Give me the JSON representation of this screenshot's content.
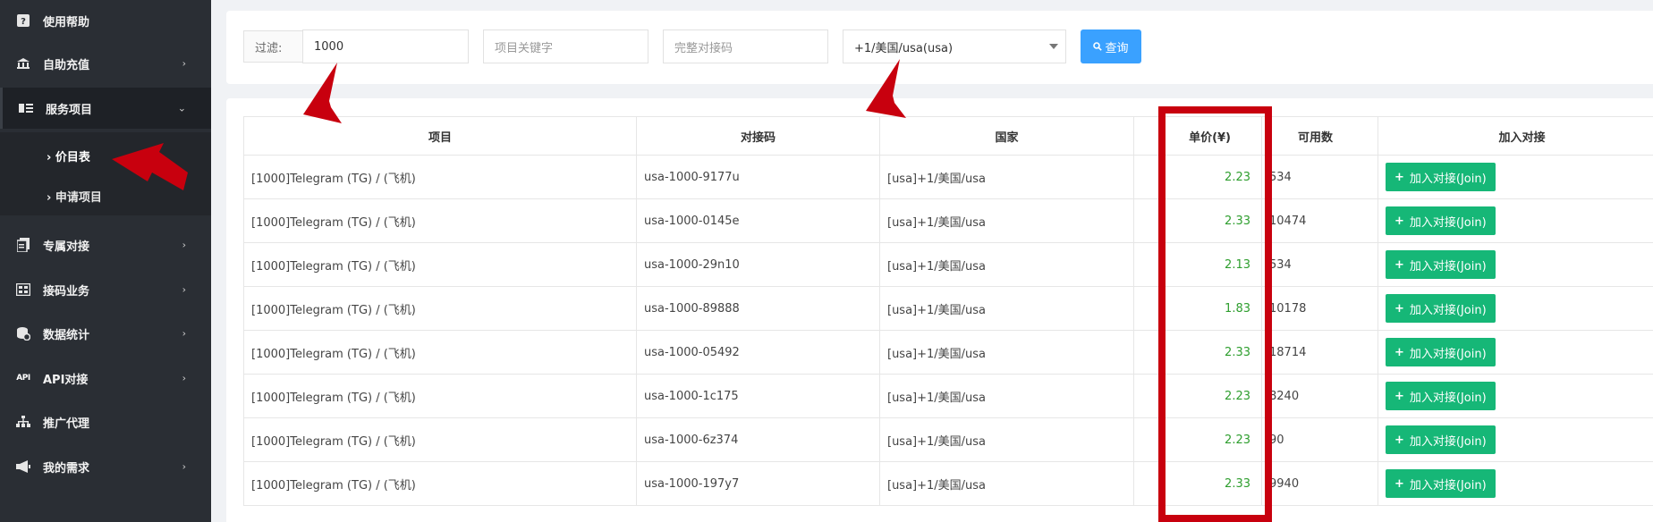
{
  "sidebar": {
    "items": [
      {
        "label": "使用帮助",
        "icon": "question-icon",
        "chevron": false
      },
      {
        "label": "自助充值",
        "icon": "bank-icon",
        "chevron": true
      },
      {
        "label": "服务项目",
        "icon": "list-icon",
        "chevron": true,
        "expanded": true
      },
      {
        "label": "专属对接",
        "icon": "document-icon",
        "chevron": true
      },
      {
        "label": "接码业务",
        "icon": "grid-icon",
        "chevron": true
      },
      {
        "label": "数据统计",
        "icon": "database-icon",
        "chevron": true
      },
      {
        "label": "API对接",
        "icon": "api-icon",
        "chevron": true
      },
      {
        "label": "推广代理",
        "icon": "sitemap-icon",
        "chevron": false
      },
      {
        "label": "我的需求",
        "icon": "bullhorn-icon",
        "chevron": true
      }
    ],
    "submenu": [
      {
        "label": "› 价目表",
        "selected": true
      },
      {
        "label": "› 申请项目",
        "selected": false
      }
    ]
  },
  "filter": {
    "label": "过滤:",
    "project_id_value": "1000",
    "keyword_placeholder": "项目关键字",
    "code_placeholder": "完整对接码",
    "country_selected": "+1/美国/usa(usa)",
    "query_label": "查询"
  },
  "table": {
    "headers": [
      "项目",
      "对接码",
      "国家",
      "单价(¥)",
      "可用数",
      "加入对接"
    ],
    "join_label": "加入对接(Join)",
    "rows": [
      {
        "project": "[1000]Telegram (TG) / (飞机)",
        "code": "usa-1000-9177u",
        "country": "[usa]+1/美国/usa",
        "price": "2.23",
        "available": "534"
      },
      {
        "project": "[1000]Telegram (TG) / (飞机)",
        "code": "usa-1000-0145e",
        "country": "[usa]+1/美国/usa",
        "price": "2.33",
        "available": "10474"
      },
      {
        "project": "[1000]Telegram (TG) / (飞机)",
        "code": "usa-1000-29n10",
        "country": "[usa]+1/美国/usa",
        "price": "2.13",
        "available": "534"
      },
      {
        "project": "[1000]Telegram (TG) / (飞机)",
        "code": "usa-1000-89888",
        "country": "[usa]+1/美国/usa",
        "price": "1.83",
        "available": "10178"
      },
      {
        "project": "[1000]Telegram (TG) / (飞机)",
        "code": "usa-1000-05492",
        "country": "[usa]+1/美国/usa",
        "price": "2.33",
        "available": "18714"
      },
      {
        "project": "[1000]Telegram (TG) / (飞机)",
        "code": "usa-1000-1c175",
        "country": "[usa]+1/美国/usa",
        "price": "2.23",
        "available": "8240"
      },
      {
        "project": "[1000]Telegram (TG) / (飞机)",
        "code": "usa-1000-6z374",
        "country": "[usa]+1/美国/usa",
        "price": "2.23",
        "available": "90"
      },
      {
        "project": "[1000]Telegram (TG) / (飞机)",
        "code": "usa-1000-197y7",
        "country": "[usa]+1/美国/usa",
        "price": "2.33",
        "available": "9940"
      }
    ]
  },
  "colors": {
    "sidebar_bg": "#2a2e34",
    "accent_blue": "#3aa1ff",
    "join_green": "#16b777",
    "price_green": "#2e9e2e",
    "annotation_red": "#c8000e"
  }
}
